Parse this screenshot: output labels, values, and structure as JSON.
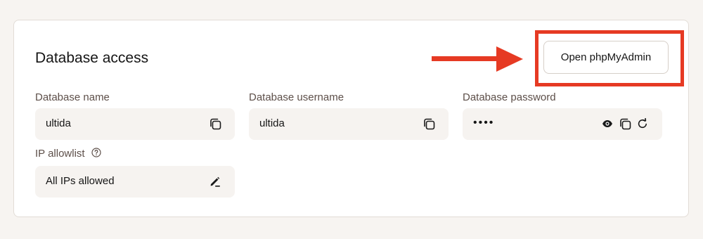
{
  "section": {
    "title": "Database access"
  },
  "actions": {
    "open_phpmyadmin_label": "Open phpMyAdmin"
  },
  "fields": {
    "database_name": {
      "label": "Database name",
      "value": "ultida",
      "icons": [
        "copy-icon"
      ]
    },
    "database_username": {
      "label": "Database username",
      "value": "ultida",
      "icons": [
        "copy-icon"
      ]
    },
    "database_password": {
      "label": "Database password",
      "value": "••••",
      "icons": [
        "eye-icon",
        "copy-icon",
        "refresh-icon"
      ]
    },
    "ip_allowlist": {
      "label": "IP allowlist",
      "value": "All IPs allowed",
      "icons": [
        "help-icon",
        "edit-icon"
      ]
    }
  },
  "annotation": {
    "arrow_color": "#e63a23",
    "highlight_color": "#e63a23"
  }
}
